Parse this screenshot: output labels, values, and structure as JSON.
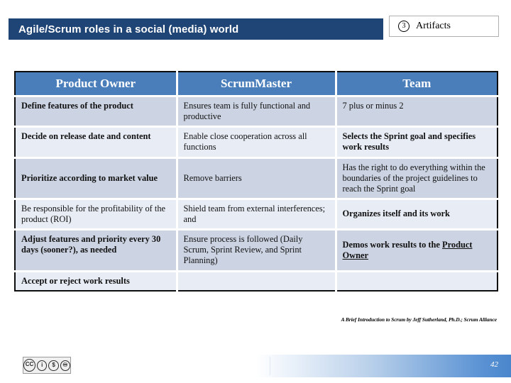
{
  "slide": {
    "title": "Agile/Scrum roles in a social (media) world",
    "badge": {
      "number": "3",
      "label": "Artifacts"
    },
    "source_note": "A Brief Introduction to Scrum by Jeff Sutherland, Ph.D.; Scrum Alliance",
    "page_number": "42",
    "cc_license": {
      "cc": "CC",
      "by": "BY",
      "nc": "NC",
      "sa": "SA"
    },
    "colors": {
      "title_bar": "#1f4476",
      "header_row": "#4a7ebb",
      "row_shade": "#ccd3e2",
      "row_light": "#e8ecf5",
      "footer_accent": "#4a86cc"
    }
  },
  "table": {
    "headers": [
      "Product Owner",
      "ScrumMaster",
      "Team"
    ],
    "rows": [
      {
        "cells": [
          "Define features of the product",
          "Ensures team is fully functional and productive",
          "7 plus or minus 2"
        ]
      },
      {
        "cells": [
          "Decide on release date and content",
          "Enable close cooperation across all functions",
          "Selects the Sprint goal and specifies work results"
        ]
      },
      {
        "cells": [
          "Prioritize according to market value",
          "Remove barriers",
          "Has the right to do everything within the boundaries of the project guidelines to reach the Sprint goal"
        ]
      },
      {
        "cells": [
          "Be responsible for the profitability of the product (ROI)",
          "Shield team from external interferences; and",
          "Organizes itself and its work"
        ]
      },
      {
        "cells": [
          "Adjust features and priority every 30 days (sooner?), as needed",
          "Ensure process is followed (Daily Scrum, Sprint Review, and Sprint Planning)",
          "Demos work results to the ",
          "Product Owner"
        ]
      },
      {
        "cells": [
          "Accept or reject work results",
          "",
          ""
        ]
      }
    ]
  }
}
